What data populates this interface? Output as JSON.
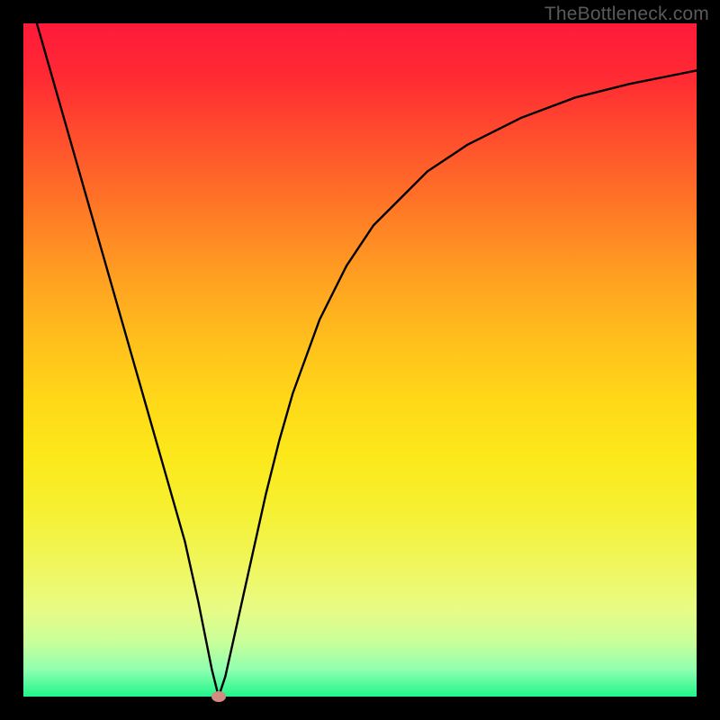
{
  "watermark_text": "TheBottleneck.com",
  "chart_data": {
    "type": "line",
    "title": "",
    "xlabel": "",
    "ylabel": "",
    "xlim": [
      0,
      100
    ],
    "ylim": [
      0,
      100
    ],
    "series": [
      {
        "name": "bottleneck-curve",
        "x": [
          2,
          4,
          6,
          8,
          10,
          12,
          14,
          16,
          18,
          20,
          22,
          24,
          26,
          27,
          28,
          29,
          30,
          32,
          34,
          36,
          38,
          40,
          44,
          48,
          52,
          56,
          60,
          66,
          74,
          82,
          90,
          100
        ],
        "values": [
          100,
          93,
          86,
          79,
          72,
          65,
          58,
          51,
          44,
          37,
          30,
          23,
          14,
          9,
          4,
          0,
          3,
          12,
          21,
          30,
          38,
          45,
          56,
          64,
          70,
          74,
          78,
          82,
          86,
          89,
          91,
          93
        ]
      }
    ],
    "annotations": [
      {
        "name": "optimum-marker",
        "x": 29,
        "y": 0,
        "color": "#d38c82"
      }
    ],
    "background_gradient": {
      "top": "#ff1a3a",
      "mid": "#ffd818",
      "bottom": "#20f58a"
    }
  }
}
